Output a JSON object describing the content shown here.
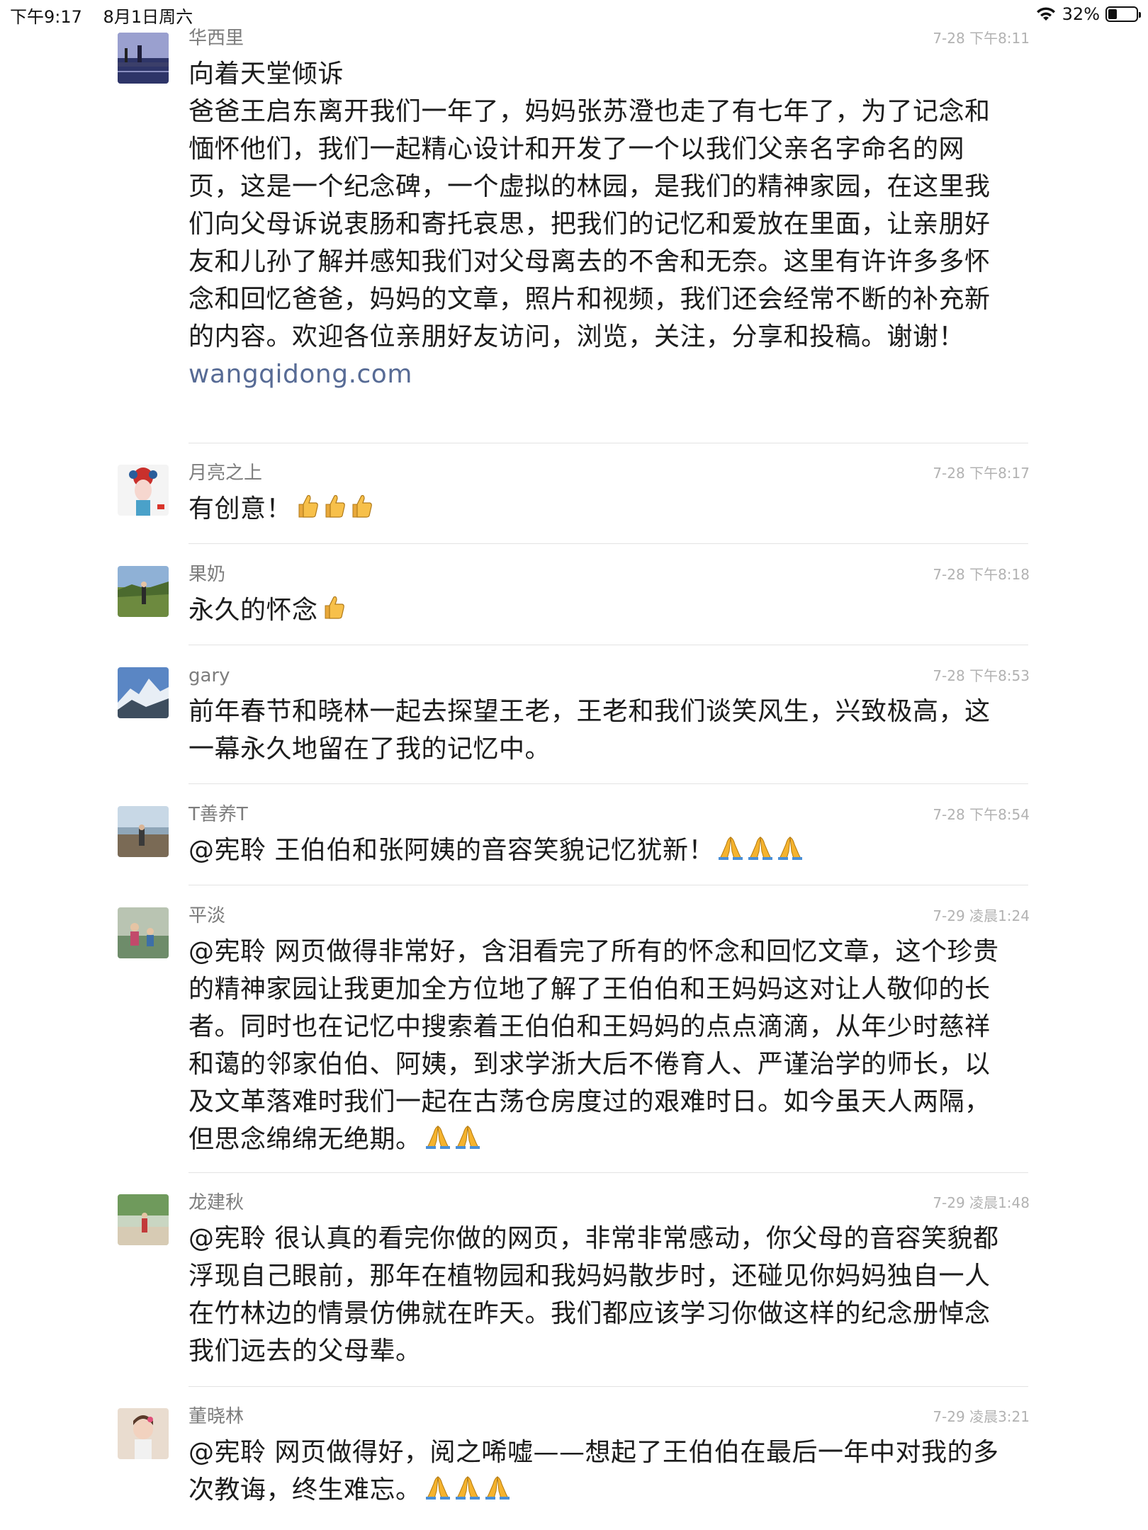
{
  "status_bar": {
    "time": "下午9:17",
    "date": "8月1日周六",
    "battery": "32%",
    "battery_level": 0.32
  },
  "comments": [
    {
      "name": "华西里",
      "time": "7-28 下午8:11",
      "title": "向着天堂倾诉",
      "text": "爸爸王启东离开我们一年了，妈妈张苏澄也走了有七年了，为了记念和愐怀他们，我们一起精心设计和开发了一个以我们父亲名字命名的网页，这是一个纪念碑，一个虚拟的林园，是我们的精神家园，在这里我们向父母诉说衷肠和寄托哀思，把我们的记忆和爱放在里面，让亲朋好友和儿孙了解并感知我们对父母离去的不舍和无奈。这里有许许多多怀念和回忆爸爸，妈妈的文章，照片和视频，我们还会经常不断的补充新的内容。欢迎各位亲朋好友访问，浏览，关注，分享和投稿。谢谢！",
      "link": "wangqidong.com"
    },
    {
      "name": "月亮之上",
      "time": "7-28 下午8:17",
      "text": "有创意！",
      "emojis": [
        "thumbs-up",
        "thumbs-up",
        "thumbs-up"
      ]
    },
    {
      "name": "果奶",
      "time": "7-28 下午8:18",
      "text": "永久的怀念",
      "emojis": [
        "thumbs-up"
      ]
    },
    {
      "name": "gary",
      "time": "7-28 下午8:53",
      "text": "前年春节和晓林一起去探望王老，王老和我们谈笑风生，兴致极高，这一幕永久地留在了我的记忆中。"
    },
    {
      "name": "T善养T",
      "time": "7-28 下午8:54",
      "text": "@宪聆 王伯伯和张阿姨的音容笑貌记忆犹新！",
      "emojis": [
        "folded-hands",
        "folded-hands",
        "folded-hands"
      ]
    },
    {
      "name": "平淡",
      "time": "7-29 凌晨1:24",
      "text": "@宪聆 网页做得非常好，含泪看完了所有的怀念和回忆文章，这个珍贵的精神家园让我更加全方位地了解了王伯伯和王妈妈这对让人敬仰的长者。同时也在记忆中搜索着王伯伯和王妈妈的点点滴滴，从年少时慈祥和蔼的邻家伯伯、阿姨，到求学浙大后不倦育人、严谨治学的师长，以及文革落难时我们一起在古荡仓房度过的艰难时日。如今虽天人两隔，但思念绵绵无绝期。",
      "emojis": [
        "folded-hands",
        "folded-hands"
      ]
    },
    {
      "name": "龙建秋",
      "time": "7-29 凌晨1:48",
      "text": "@宪聆 很认真的看完你做的网页，非常非常感动，你父母的音容笑貌都浮现自己眼前，那年在植物园和我妈妈散步时，还碰见你妈妈独自一人在竹林边的情景仿佛就在昨天。我们都应该学习你做这样的纪念册悼念我们远去的父母辈。"
    },
    {
      "name": "董晓林",
      "time": "7-29 凌晨3:21",
      "text": "@宪聆 网页做得好，阅之唏嘘——想起了王伯伯在最后一年中对我的多次教诲，终生难忘。",
      "emojis": [
        "folded-hands",
        "folded-hands",
        "folded-hands"
      ]
    }
  ]
}
